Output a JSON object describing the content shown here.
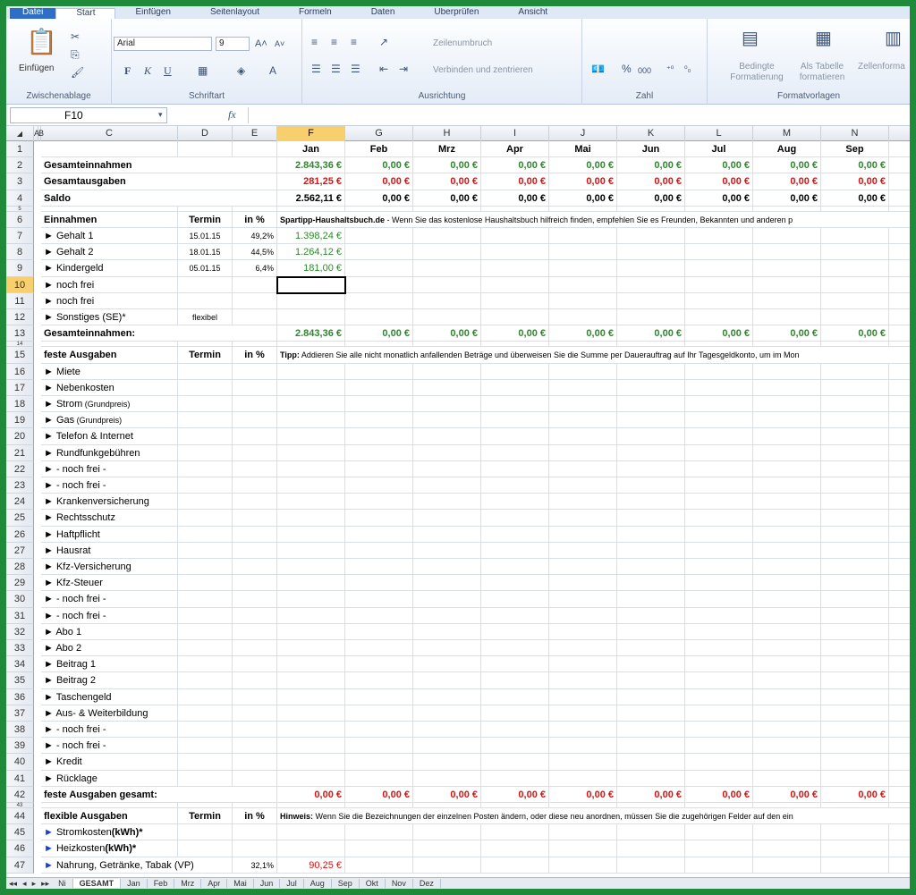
{
  "ribbon": {
    "tabs": [
      "Datei",
      "Start",
      "Einfügen",
      "Seitenlayout",
      "Formeln",
      "Daten",
      "Überprüfen",
      "Ansicht"
    ],
    "paste_label": "Einfügen",
    "font_name": "Arial",
    "font_size": "9",
    "wrap_text": "Zeilenumbruch",
    "merge_center": "Verbinden und zentrieren",
    "conditional_format": "Bedingte Formatierung",
    "format_as_table": "Als Tabelle formatieren",
    "cell_styles": "Zellenforma",
    "groups": {
      "clipboard": "Zwischenablage",
      "font": "Schriftart",
      "alignment": "Ausrichtung",
      "number": "Zahl",
      "styles": "Formatvorlagen"
    },
    "bold": "F",
    "italic": "K",
    "underline": "U"
  },
  "formula_bar": {
    "name_box": "F10",
    "fx": "fx",
    "content": ""
  },
  "columns": [
    "A",
    "B",
    "C",
    "D",
    "E",
    "F",
    "G",
    "H",
    "I",
    "J",
    "K",
    "L",
    "M",
    "N"
  ],
  "months": [
    "Jan",
    "Feb",
    "Mrz",
    "Apr",
    "Mai",
    "Jun",
    "Jul",
    "Aug",
    "Sep"
  ],
  "summary": {
    "income_label": "Gesamteinnahmen",
    "expenses_label": "Gesamtausgaben",
    "balance_label": "Saldo",
    "income": [
      "2.843,36 €",
      "0,00 €",
      "0,00 €",
      "0,00 €",
      "0,00 €",
      "0,00 €",
      "0,00 €",
      "0,00 €",
      "0,00 €"
    ],
    "expenses": [
      "281,25 €",
      "0,00 €",
      "0,00 €",
      "0,00 €",
      "0,00 €",
      "0,00 €",
      "0,00 €",
      "0,00 €",
      "0,00 €"
    ],
    "balance": [
      "2.562,11 €",
      "0,00 €",
      "0,00 €",
      "0,00 €",
      "0,00 €",
      "0,00 €",
      "0,00 €",
      "0,00 €",
      "0,00 €"
    ]
  },
  "income_section": {
    "header": "Einnahmen",
    "termin": "Termin",
    "pct": "in %",
    "note_bold": "Spartipp-Haushaltsbuch.de",
    "note": " - Wenn Sie das kostenlose Haushaltsbuch hilfreich finden, empfehlen Sie es Freunden, Bekannten und anderen p",
    "items": [
      {
        "label": "Gehalt 1",
        "termin": "15.01.15",
        "pct": "49,2%",
        "jan": "1.398,24 €"
      },
      {
        "label": "Gehalt 2",
        "termin": "18.01.15",
        "pct": "44,5%",
        "jan": "1.264,12 €"
      },
      {
        "label": "Kindergeld",
        "termin": "05.01.15",
        "pct": "6,4%",
        "jan": "181,00 €"
      },
      {
        "label": "noch frei",
        "termin": "",
        "pct": "",
        "jan": ""
      },
      {
        "label": "noch frei",
        "termin": "",
        "pct": "",
        "jan": ""
      },
      {
        "label": "Sonstiges (SE)*",
        "termin": "flexibel",
        "pct": "",
        "jan": ""
      }
    ],
    "total_label": "Gesamteinnahmen:",
    "totals": [
      "2.843,36 €",
      "0,00 €",
      "0,00 €",
      "0,00 €",
      "0,00 €",
      "0,00 €",
      "0,00 €",
      "0,00 €",
      "0,00 €"
    ]
  },
  "fixed_section": {
    "header": "feste Ausgaben",
    "termin": "Termin",
    "pct": "in %",
    "note_bold": "Tipp:",
    "note": " Addieren Sie alle nicht monatlich anfallenden Beträge und überweisen Sie die Summe per Dauerauftrag auf Ihr Tagesgeldkonto, um im Mon",
    "items": [
      "Miete",
      "Nebenkosten",
      "Strom|(Grundpreis)",
      "Gas|(Grundpreis)",
      "Telefon & Internet",
      "Rundfunkgebühren",
      " - noch frei -",
      " - noch frei -",
      "Krankenversicherung",
      "Rechtsschutz",
      "Haftpflicht",
      "Hausrat",
      "Kfz-Versicherung",
      "Kfz-Steuer",
      " - noch frei -",
      " - noch frei -",
      "Abo 1",
      "Abo 2",
      "Beitrag 1",
      "Beitrag 2",
      "Taschengeld",
      "Aus- & Weiterbildung",
      " - noch frei -",
      " - noch frei -",
      "Kredit",
      "Rücklage"
    ],
    "total_label": "feste Ausgaben gesamt:",
    "totals": [
      "0,00 €",
      "0,00 €",
      "0,00 €",
      "0,00 €",
      "0,00 €",
      "0,00 €",
      "0,00 €",
      "0,00 €",
      "0,00 €"
    ]
  },
  "flex_section": {
    "header": "flexible Ausgaben",
    "termin": "Termin",
    "pct": "in %",
    "note_bold": "Hinweis:",
    "note": " Wenn Sie die Bezeichnungen der einzelnen Posten ändern, oder diese neu anordnen, müssen Sie die zugehörigen Felder auf den ein",
    "items": [
      {
        "label": "Stromkosten",
        "bold": "(kWh)*",
        "pct": "",
        "jan": ""
      },
      {
        "label": "Heizkosten",
        "bold": "(kWh)*",
        "pct": "",
        "jan": ""
      },
      {
        "label": "Nahrung, Getränke, Tabak (VP)",
        "bold": "",
        "pct": "32,1%",
        "jan": "90,25 €"
      }
    ]
  },
  "sheet_tabs": [
    "Ni",
    "GESAMT",
    "Jan",
    "Feb",
    "Mrz",
    "Apr",
    "Mai",
    "Jun",
    "Jul",
    "Aug",
    "Sep",
    "Okt",
    "Nov",
    "Dez"
  ]
}
